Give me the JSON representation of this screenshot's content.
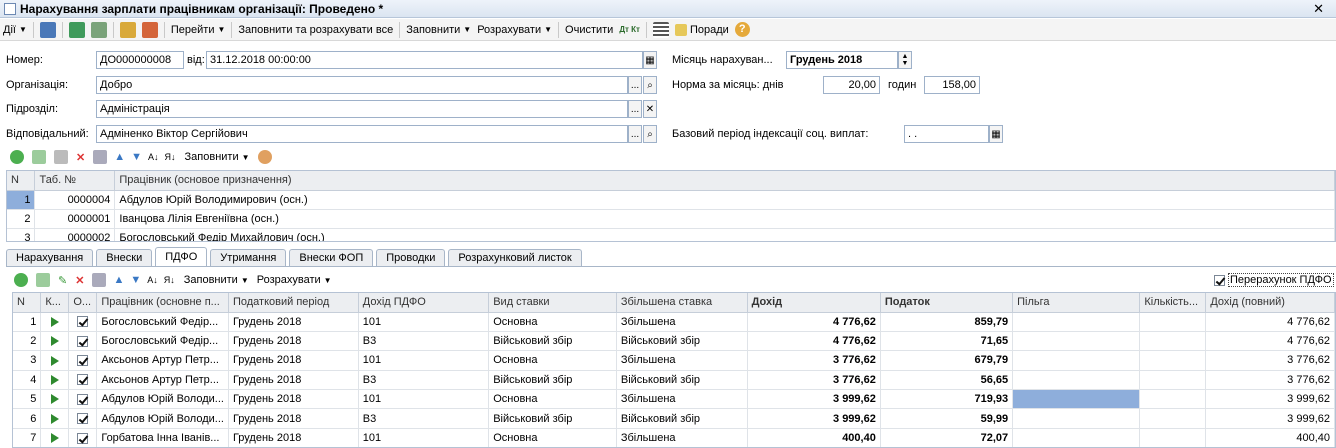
{
  "window": {
    "title": "Нарахування зарплати працівникам організації: Проведено *"
  },
  "toolbar": {
    "actions_label": "Дії",
    "goto_label": "Перейти",
    "fill_calc_all_label": "Заповнити та розрахувати все",
    "fill_label": "Заповнити",
    "calculate_label": "Розрахувати",
    "clear_label": "Очистити",
    "dt_kt_label": "Дт Кт",
    "tips_label": "Поради"
  },
  "header": {
    "number_label": "Номер:",
    "number_value": "ДО000000008",
    "from_label": "від:",
    "date_value": "31.12.2018 00:00:00",
    "month_label": "Місяць нарахуван...",
    "month_value": "Грудень 2018",
    "org_label": "Організація:",
    "org_value": "Добро",
    "norm_label": "Норма за місяць: днів",
    "norm_days": "20,00",
    "hours_label": "годин",
    "norm_hours": "158,00",
    "dept_label": "Підрозділ:",
    "dept_value": "Адміністрація",
    "resp_label": "Відповідальний:",
    "resp_value": "Адміненко Віктор Сергійович",
    "base_period_label": "Базовий період індексації соц. виплат:",
    "base_period_value": ". ."
  },
  "employees_toolbar": {
    "fill_label": "Заповнити"
  },
  "employees": {
    "columns": [
      "N",
      "Таб. №",
      "Працівник (основое призначення)"
    ],
    "rows": [
      {
        "n": "1",
        "tab": "0000004",
        "name": "Абдулов Юрій Володимирович (осн.)"
      },
      {
        "n": "2",
        "tab": "0000001",
        "name": "Іванцова Лілія Евгеніївна (осн.)"
      },
      {
        "n": "3",
        "tab": "0000002",
        "name": "Богословський Федір Михайлович (осн.)"
      }
    ]
  },
  "tabs": [
    {
      "label": "Нарахування"
    },
    {
      "label": "Внески"
    },
    {
      "label": "ПДФО"
    },
    {
      "label": "Утримання"
    },
    {
      "label": "Внески ФОП"
    },
    {
      "label": "Проводки"
    },
    {
      "label": "Розрахунковий листок"
    }
  ],
  "pdfo_toolbar": {
    "fill_label": "Заповнити",
    "calculate_label": "Розрахувати",
    "recalc_label": "Перерахунок ПДФО"
  },
  "pdfo": {
    "columns": [
      "N",
      "К...",
      "О...",
      "Працівник (основне п...",
      "Податковий період",
      "Дохід ПДФО",
      "Вид ставки",
      "Збільшена ставка",
      "Дохід",
      "Податок",
      "Пільга",
      "Кількість...",
      "Дохід (повний)"
    ],
    "rows": [
      {
        "n": "1",
        "emp": "Богословський Федір...",
        "period": "Грудень 2018",
        "code": "101",
        "rate": "Основна",
        "inc": "Збільшена",
        "income": "4 776,62",
        "tax": "859,79",
        "relief": "",
        "qty": "",
        "full": "4 776,62"
      },
      {
        "n": "2",
        "emp": "Богословський Федір...",
        "period": "Грудень 2018",
        "code": "В3",
        "rate": "Військовий збір",
        "inc": "Військовий збір",
        "income": "4 776,62",
        "tax": "71,65",
        "relief": "",
        "qty": "",
        "full": "4 776,62"
      },
      {
        "n": "3",
        "emp": "Аксьонов Артур Петр...",
        "period": "Грудень 2018",
        "code": "101",
        "rate": "Основна",
        "inc": "Збільшена",
        "income": "3 776,62",
        "tax": "679,79",
        "relief": "",
        "qty": "",
        "full": "3 776,62"
      },
      {
        "n": "4",
        "emp": "Аксьонов Артур Петр...",
        "period": "Грудень 2018",
        "code": "В3",
        "rate": "Військовий збір",
        "inc": "Військовий збір",
        "income": "3 776,62",
        "tax": "56,65",
        "relief": "",
        "qty": "",
        "full": "3 776,62"
      },
      {
        "n": "5",
        "emp": "Абдулов Юрій Володи...",
        "period": "Грудень 2018",
        "code": "101",
        "rate": "Основна",
        "inc": "Збільшена",
        "income": "3 999,62",
        "tax": "719,93",
        "relief": "",
        "qty": "",
        "full": "3 999,62"
      },
      {
        "n": "6",
        "emp": "Абдулов Юрій Володи...",
        "period": "Грудень 2018",
        "code": "В3",
        "rate": "Військовий збір",
        "inc": "Військовий збір",
        "income": "3 999,62",
        "tax": "59,99",
        "relief": "",
        "qty": "",
        "full": "3 999,62"
      },
      {
        "n": "7",
        "emp": "Горбатова Інна Іванів...",
        "period": "Грудень 2018",
        "code": "101",
        "rate": "Основна",
        "inc": "Збільшена",
        "income": "400,40",
        "tax": "72,07",
        "relief": "",
        "qty": "",
        "full": "400,40"
      }
    ]
  },
  "colors": {
    "accent": "#8eaedb",
    "selection": "#dbe6f4",
    "border": "#9eb1c9"
  }
}
